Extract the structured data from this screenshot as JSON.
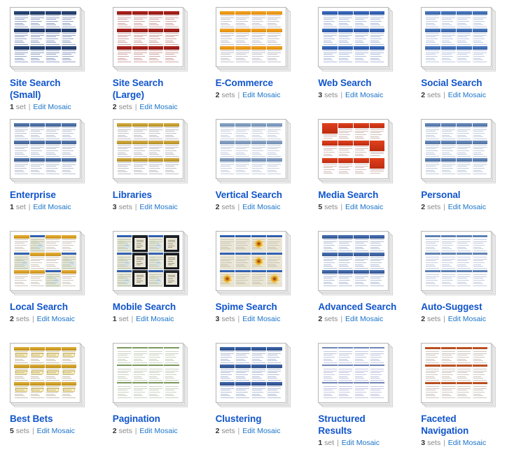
{
  "page": {
    "background": "#ffffff",
    "link_color": "#1155cc",
    "edit_link_color": "#1a73c8",
    "columns": 5,
    "rows": 4
  },
  "labels": {
    "edit_mosaic": "Edit Mosaic",
    "separator": "|",
    "unit_singular": "set",
    "unit_plural": "sets"
  },
  "items": [
    {
      "title": "Site Search (Small)",
      "count": "1",
      "unit": "set",
      "edit": "Edit Mosaic",
      "theme": "t-blue",
      "thumb_name": "thumbnail-site-search-small"
    },
    {
      "title": "Site Search (Large)",
      "count": "2",
      "unit": "sets",
      "edit": "Edit Mosaic",
      "theme": "t-red",
      "thumb_name": "thumbnail-site-search-large"
    },
    {
      "title": "E-Commerce",
      "count": "2",
      "unit": "sets",
      "edit": "Edit Mosaic",
      "theme": "t-ecom",
      "thumb_name": "thumbnail-e-commerce"
    },
    {
      "title": "Web Search",
      "count": "3",
      "unit": "sets",
      "edit": "Edit Mosaic",
      "theme": "t-web",
      "thumb_name": "thumbnail-web-search"
    },
    {
      "title": "Social Search",
      "count": "2",
      "unit": "sets",
      "edit": "Edit Mosaic",
      "theme": "t-social",
      "thumb_name": "thumbnail-social-search"
    },
    {
      "title": "Enterprise",
      "count": "1",
      "unit": "set",
      "edit": "Edit Mosaic",
      "theme": "t-ent",
      "thumb_name": "thumbnail-enterprise"
    },
    {
      "title": "Libraries",
      "count": "3",
      "unit": "sets",
      "edit": "Edit Mosaic",
      "theme": "t-lib",
      "thumb_name": "thumbnail-libraries"
    },
    {
      "title": "Vertical Search",
      "count": "2",
      "unit": "sets",
      "edit": "Edit Mosaic",
      "theme": "t-vert",
      "thumb_name": "thumbnail-vertical-search"
    },
    {
      "title": "Media Search",
      "count": "5",
      "unit": "sets",
      "edit": "Edit Mosaic",
      "theme": "t-media",
      "thumb_name": "thumbnail-media-search"
    },
    {
      "title": "Personal",
      "count": "2",
      "unit": "sets",
      "edit": "Edit Mosaic",
      "theme": "t-pers",
      "thumb_name": "thumbnail-personal"
    },
    {
      "title": "Local Search",
      "count": "2",
      "unit": "sets",
      "edit": "Edit Mosaic",
      "theme": "t-local",
      "thumb_name": "thumbnail-local-search"
    },
    {
      "title": "Mobile Search",
      "count": "1",
      "unit": "set",
      "edit": "Edit Mosaic",
      "theme": "t-mobile",
      "thumb_name": "thumbnail-mobile-search"
    },
    {
      "title": "Spime Search",
      "count": "3",
      "unit": "sets",
      "edit": "Edit Mosaic",
      "theme": "t-spime",
      "thumb_name": "thumbnail-spime-search"
    },
    {
      "title": "Advanced Search",
      "count": "2",
      "unit": "sets",
      "edit": "Edit Mosaic",
      "theme": "t-adv",
      "thumb_name": "thumbnail-advanced-search"
    },
    {
      "title": "Auto-Suggest",
      "count": "2",
      "unit": "sets",
      "edit": "Edit Mosaic",
      "theme": "t-auto",
      "thumb_name": "thumbnail-auto-suggest"
    },
    {
      "title": "Best Bets",
      "count": "5",
      "unit": "sets",
      "edit": "Edit Mosaic",
      "theme": "t-best",
      "thumb_name": "thumbnail-best-bets"
    },
    {
      "title": "Pagination",
      "count": "2",
      "unit": "sets",
      "edit": "Edit Mosaic",
      "theme": "t-pag",
      "thumb_name": "thumbnail-pagination"
    },
    {
      "title": "Clustering",
      "count": "2",
      "unit": "sets",
      "edit": "Edit Mosaic",
      "theme": "t-clu",
      "thumb_name": "thumbnail-clustering"
    },
    {
      "title": "Structured Results",
      "count": "1",
      "unit": "set",
      "edit": "Edit Mosaic",
      "theme": "t-struct",
      "thumb_name": "thumbnail-structured-results"
    },
    {
      "title": "Faceted Navigation",
      "count": "3",
      "unit": "sets",
      "edit": "Edit Mosaic",
      "theme": "t-facet",
      "thumb_name": "thumbnail-faceted-navigation"
    }
  ]
}
